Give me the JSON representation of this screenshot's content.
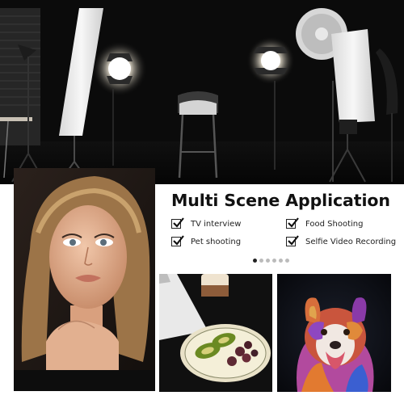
{
  "headline": "Multi Scene Application",
  "features": [
    {
      "label": "TV interview"
    },
    {
      "label": "Food Shooting"
    },
    {
      "label": "Pet shooting"
    },
    {
      "label": "Selfie Video Recording"
    }
  ],
  "carousel": {
    "count": 6,
    "active_index": 0
  },
  "colors": {
    "accent": "#111111",
    "dot_active": "#222222",
    "dot_inactive": "#bbbbbb"
  }
}
